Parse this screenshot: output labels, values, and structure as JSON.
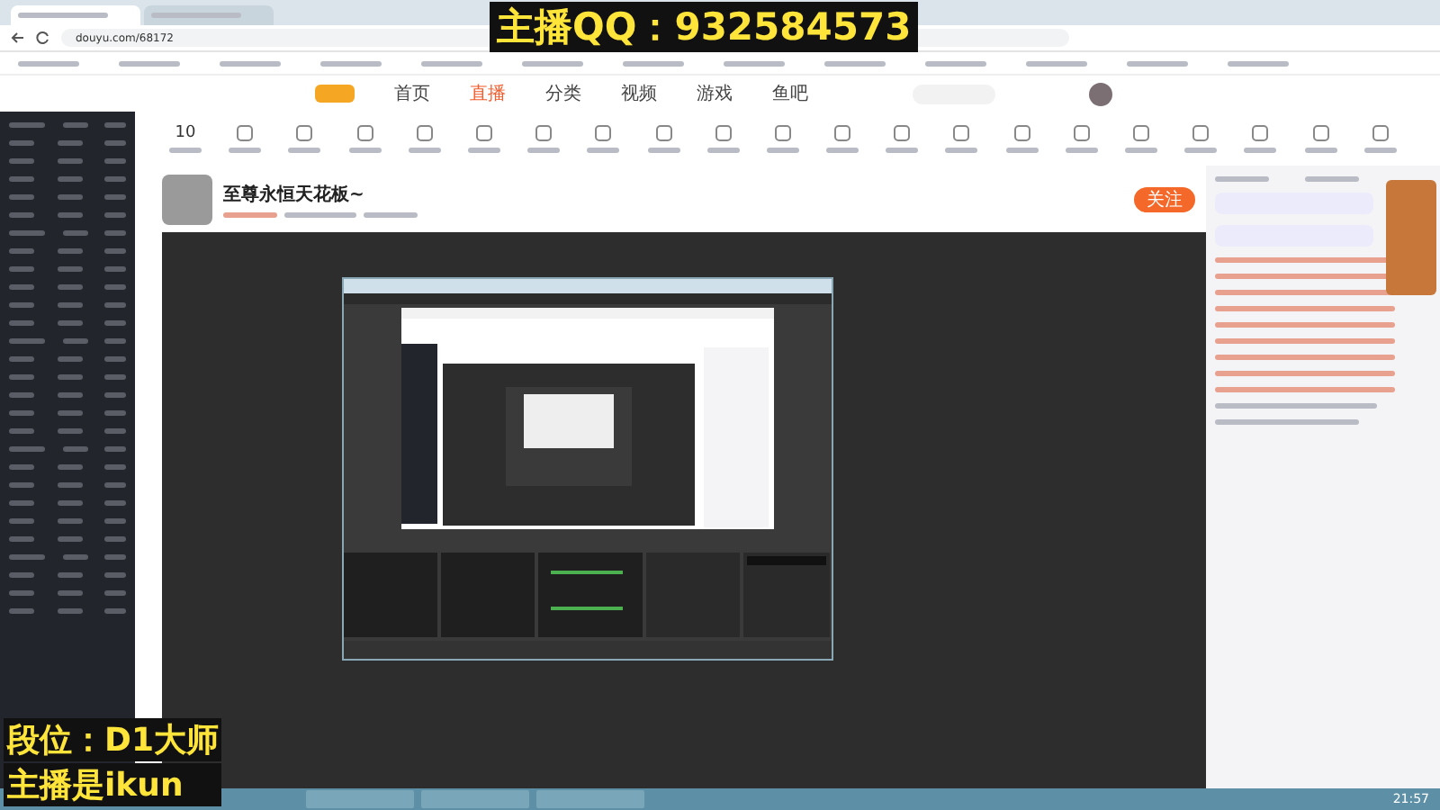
{
  "overlay": {
    "qq": "主播QQ：932584573",
    "lines": [
      "段位：D1大师",
      "主播是ikun"
    ]
  },
  "browser": {
    "tabs": [
      {
        "selected": true
      },
      {
        "selected": false
      }
    ],
    "url": "douyu.com/68172"
  },
  "site": {
    "nav": [
      {
        "label": "首页",
        "selected": false
      },
      {
        "label": "直播",
        "selected": true
      },
      {
        "label": "分类",
        "selected": false
      },
      {
        "label": "视频",
        "selected": false
      },
      {
        "label": "游戏",
        "selected": false
      },
      {
        "label": "鱼吧",
        "selected": false
      }
    ]
  },
  "stat": {
    "value": "10"
  },
  "room": {
    "title": "至尊永恒天花板~",
    "follow": "关注"
  },
  "taskbar": {
    "time": "21:57"
  }
}
